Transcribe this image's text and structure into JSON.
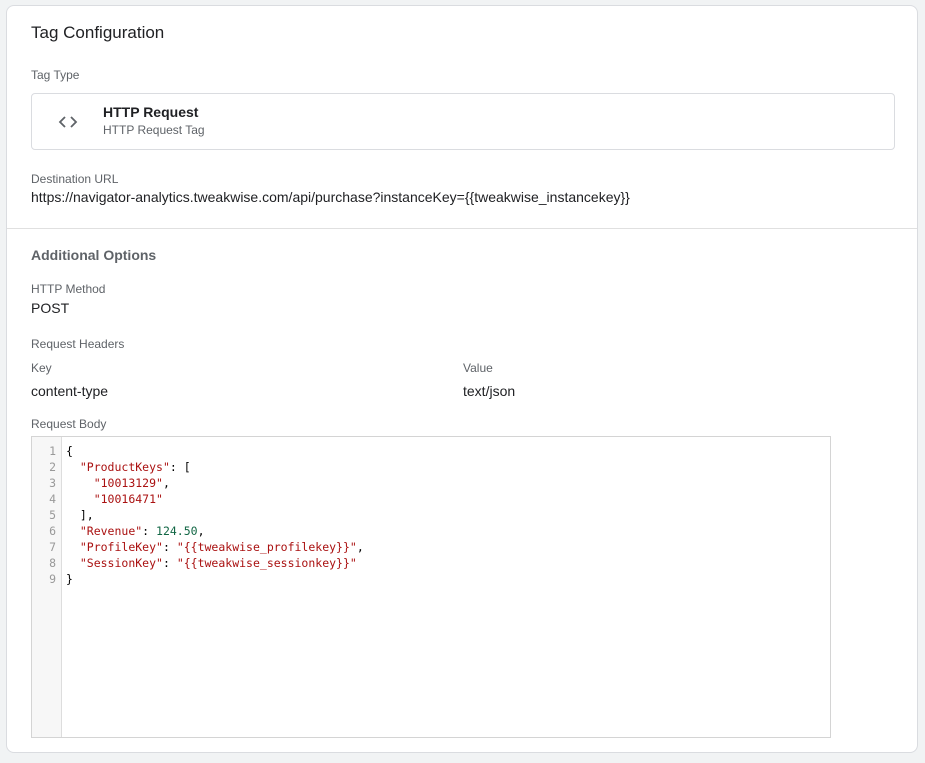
{
  "card": {
    "title": "Tag Configuration"
  },
  "tag_type": {
    "label": "Tag Type",
    "icon": "code-brackets-icon",
    "name": "HTTP Request",
    "subtitle": "HTTP Request Tag"
  },
  "destination": {
    "label": "Destination URL",
    "url": "https://navigator-analytics.tweakwise.com/api/purchase?instanceKey={{tweakwise_instancekey}}"
  },
  "additional_options": {
    "title": "Additional Options",
    "http_method": {
      "label": "HTTP Method",
      "value": "POST"
    },
    "request_headers": {
      "label": "Request Headers",
      "key_header": "Key",
      "value_header": "Value",
      "rows": [
        {
          "key": "content-type",
          "value": "text/json"
        }
      ]
    },
    "request_body": {
      "label": "Request Body",
      "line_numbers": [
        "1",
        "2",
        "3",
        "4",
        "5",
        "6",
        "7",
        "8",
        "9"
      ],
      "lines": [
        [
          {
            "t": "punc",
            "v": "{"
          }
        ],
        [
          {
            "t": "punc",
            "v": "  "
          },
          {
            "t": "key",
            "v": "\"ProductKeys\""
          },
          {
            "t": "punc",
            "v": ": ["
          }
        ],
        [
          {
            "t": "punc",
            "v": "    "
          },
          {
            "t": "str",
            "v": "\"10013129\""
          },
          {
            "t": "punc",
            "v": ","
          }
        ],
        [
          {
            "t": "punc",
            "v": "    "
          },
          {
            "t": "str",
            "v": "\"10016471\""
          }
        ],
        [
          {
            "t": "punc",
            "v": "  ],"
          }
        ],
        [
          {
            "t": "punc",
            "v": "  "
          },
          {
            "t": "key",
            "v": "\"Revenue\""
          },
          {
            "t": "punc",
            "v": ": "
          },
          {
            "t": "num",
            "v": "124.50"
          },
          {
            "t": "punc",
            "v": ","
          }
        ],
        [
          {
            "t": "punc",
            "v": "  "
          },
          {
            "t": "key",
            "v": "\"ProfileKey\""
          },
          {
            "t": "punc",
            "v": ": "
          },
          {
            "t": "str",
            "v": "\"{{tweakwise_profilekey}}\""
          },
          {
            "t": "punc",
            "v": ","
          }
        ],
        [
          {
            "t": "punc",
            "v": "  "
          },
          {
            "t": "key",
            "v": "\"SessionKey\""
          },
          {
            "t": "punc",
            "v": ": "
          },
          {
            "t": "str",
            "v": "\"{{tweakwise_sessionkey}}\""
          }
        ],
        [
          {
            "t": "punc",
            "v": "}"
          }
        ]
      ]
    }
  }
}
